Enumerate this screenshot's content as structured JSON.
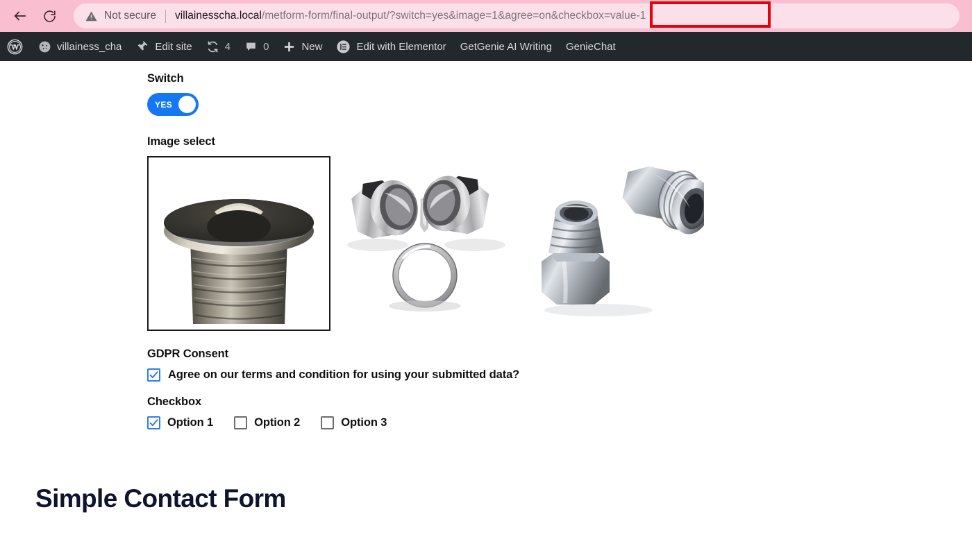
{
  "browser": {
    "back_icon": "back-arrow-icon",
    "reload_icon": "reload-icon",
    "security_icon": "not-secure-warning-icon",
    "security_label": "Not secure",
    "url_host": "villainesscha.local",
    "url_path": "/metform-form/final-output/?switch=yes&image=1&agree=on",
    "url_highlighted": "&checkbox=value-1",
    "highlight_color": "#e8000b"
  },
  "adminbar": {
    "items": [
      {
        "icon": "wordpress-logo-icon",
        "label": ""
      },
      {
        "icon": "dashboard-icon",
        "label": "villainess_cha"
      },
      {
        "icon": "pushpin-icon",
        "label": "Edit site"
      },
      {
        "icon": "update-icon",
        "label": "4"
      },
      {
        "icon": "comment-bubble-icon",
        "label": "0"
      },
      {
        "icon": "plus-icon",
        "label": "New"
      },
      {
        "icon": "elementor-icon",
        "label": "Edit with Elementor"
      },
      {
        "icon": "",
        "label": "GetGenie AI Writing"
      },
      {
        "icon": "",
        "label": "GenieChat"
      }
    ],
    "bg_color": "#23282d"
  },
  "form": {
    "switch": {
      "label": "Switch",
      "value": "YES",
      "state": "on",
      "accent_color": "#1677f2"
    },
    "image_select": {
      "label": "Image select",
      "options": [
        {
          "name": "flanged-hex-socket-plug",
          "selected": true
        },
        {
          "name": "two-hex-fittings-with-seal-ring",
          "selected": false
        },
        {
          "name": "two-jic-flare-fittings",
          "selected": false
        }
      ],
      "selected_border_color": "#1a1a1a"
    },
    "gdpr": {
      "label": "GDPR Consent",
      "checkbox": {
        "text": "Agree on our terms and condition for using your submitted data?",
        "checked": true
      }
    },
    "checkbox": {
      "label": "Checkbox",
      "accent_color": "#2f7bf0",
      "options": [
        {
          "text": "Option 1",
          "checked": true
        },
        {
          "text": "Option 2",
          "checked": false
        },
        {
          "text": "Option 3",
          "checked": false
        }
      ]
    }
  },
  "heading": {
    "title": "Simple Contact Form",
    "color": "#0e1330"
  }
}
